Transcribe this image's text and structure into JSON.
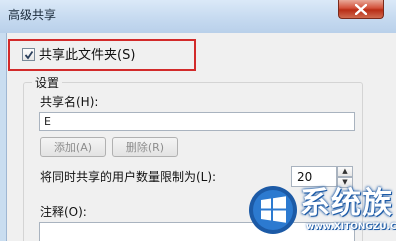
{
  "window": {
    "title": "高级共享",
    "close_icon": "close-icon"
  },
  "share_checkbox": {
    "label": "共享此文件夹(S)",
    "checked": true
  },
  "settings_group": {
    "legend": "设置",
    "share_name_label": "共享名(H):",
    "share_name_value": "E",
    "add_button": "添加(A)",
    "remove_button": "删除(R)",
    "limit_label": "将同时共享的用户数量限制为(L):",
    "limit_value": "20",
    "comment_label": "注释(O):",
    "comment_value": ""
  },
  "watermark": {
    "brand": "系统族",
    "url": "www.XITONGZU.COM"
  },
  "colors": {
    "highlight": "#d22a2a",
    "close_button": "#c8442c",
    "brand_blue": "#1c5aa6"
  }
}
